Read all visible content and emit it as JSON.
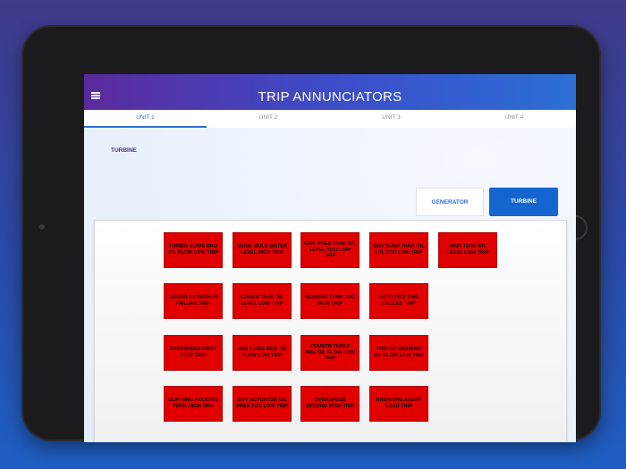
{
  "app": {
    "title": "TRIP ANNUNCIATORS"
  },
  "tabs": [
    {
      "label": "UNIT 1",
      "active": true
    },
    {
      "label": "UNIT 2",
      "active": false
    },
    {
      "label": "UNIT 3",
      "active": false
    },
    {
      "label": "UNIT 4",
      "active": false
    }
  ],
  "section": {
    "label": "TURBINE"
  },
  "toggle": {
    "generator_label": "GENERATOR",
    "turbine_label": "TURBINE",
    "selected": "TURBINE"
  },
  "colors": {
    "trip_active": "#e00000",
    "accent": "#1565d0"
  },
  "icons": {
    "menu": "hamburger-menu-icon"
  },
  "annunciators": [
    [
      "TURBIN GUIDE BRG OIL FLOW LOW TRIP",
      "GENR. BULB WATER LEVEL HIGH TRIP",
      "GOV. PRES TANK OIL LEVEL TOO LOW TRIP",
      "GOV SUMP TANK OIL LVL TOO LOW TRIP",
      "HIGH TANK OIL LEVEL LOW TRIP"
    ],
    [
      "TURBIN GOVERNOR FAILURE TRIP",
      "LOWER TANK OIL LEVEL LOW TRIP",
      "BEARING TEMP TOO HIGH TRIP",
      "ARTO SEQ TIME EXCEED TRIP"
    ],
    [
      "OVERSPEED FIRST STEP TRIP",
      "GEN GUIDE BRG OIL FLOW LOW TRIP",
      "COUNTR THRST BRG OIL FLOW LOW TRIP",
      "THRUST BEARING OIL FLOW LOW TRIP"
    ],
    [
      "SLIP RING HOUSING TEMP. HIGH TRIP",
      "GOV ACTUATOR OIL PRES TOO LOW TRIP",
      "OVERSPEED SECOND STEP TRIP",
      "BREAKING AGENT LOAD TRIP"
    ]
  ]
}
